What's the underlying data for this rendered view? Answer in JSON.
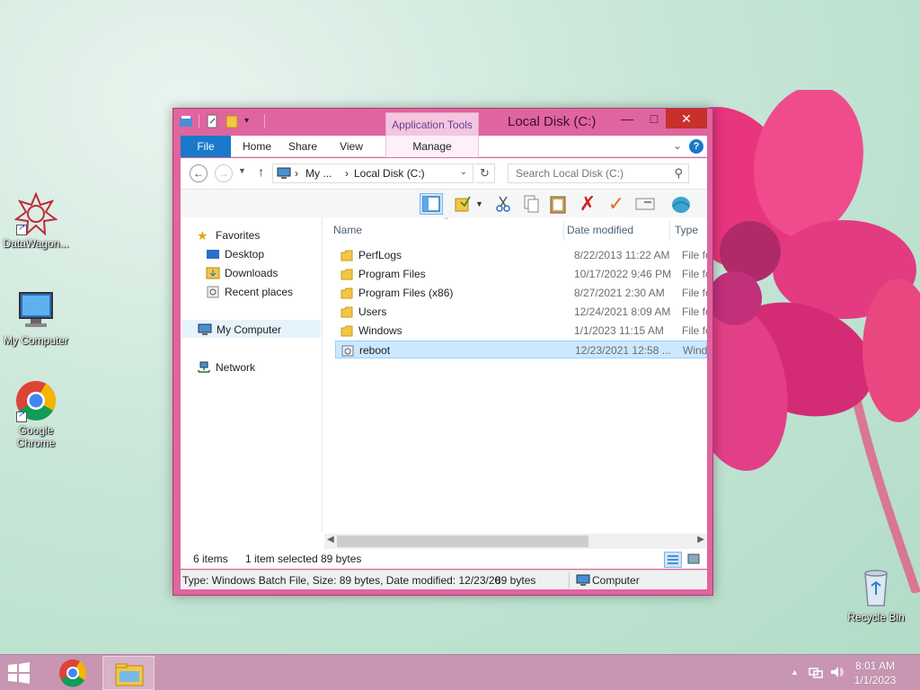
{
  "desktop": {
    "icons": [
      {
        "label": "DataWagon..."
      },
      {
        "label": "My Computer"
      },
      {
        "label": "Google Chrome"
      },
      {
        "label": "Recycle Bin"
      }
    ]
  },
  "window": {
    "title": "Local Disk (C:)",
    "context_tab_group": "Application Tools",
    "ribbon_tabs": [
      "File",
      "Home",
      "Share",
      "View",
      "Manage"
    ],
    "address": {
      "crumbs": [
        "My ...",
        "Local Disk (C:)"
      ],
      "separator": "›",
      "search_placeholder": "Search Local Disk (C:)"
    },
    "nav_pane": {
      "favorites_label": "Favorites",
      "favorites": [
        "Desktop",
        "Downloads",
        "Recent places"
      ],
      "my_computer": "My Computer",
      "network": "Network"
    },
    "columns": {
      "name": "Name",
      "date_modified": "Date modified",
      "type": "Type"
    },
    "files": [
      {
        "name": "PerfLogs",
        "date": "8/22/2013 11:22 AM",
        "type": "File fo",
        "kind": "folder"
      },
      {
        "name": "Program Files",
        "date": "10/17/2022 9:46 PM",
        "type": "File fo",
        "kind": "folder"
      },
      {
        "name": "Program Files (x86)",
        "date": "8/27/2021 2:30 AM",
        "type": "File fo",
        "kind": "folder"
      },
      {
        "name": "Users",
        "date": "12/24/2021 8:09 AM",
        "type": "File fo",
        "kind": "folder"
      },
      {
        "name": "Windows",
        "date": "1/1/2023 11:15 AM",
        "type": "File fo",
        "kind": "folder"
      },
      {
        "name": "reboot",
        "date": "12/23/2021 12:58 ...",
        "type": "Wind",
        "kind": "batch",
        "selected": true
      }
    ],
    "status": {
      "items": "6 items",
      "selected": "1 item selected",
      "size": "89 bytes"
    },
    "infobar": {
      "details": "Type: Windows Batch File, Size: 89 bytes, Date modified: 12/23/20",
      "size": "89 bytes",
      "location": "Computer"
    }
  },
  "taskbar": {
    "clock_time": "8:01 AM",
    "clock_date": "1/1/2023"
  },
  "colors": {
    "window_frame": "#e0649e",
    "close_button": "#c7302b",
    "file_tab": "#1979ca",
    "selection": "#cce8ff",
    "taskbar": "#c895b3"
  }
}
